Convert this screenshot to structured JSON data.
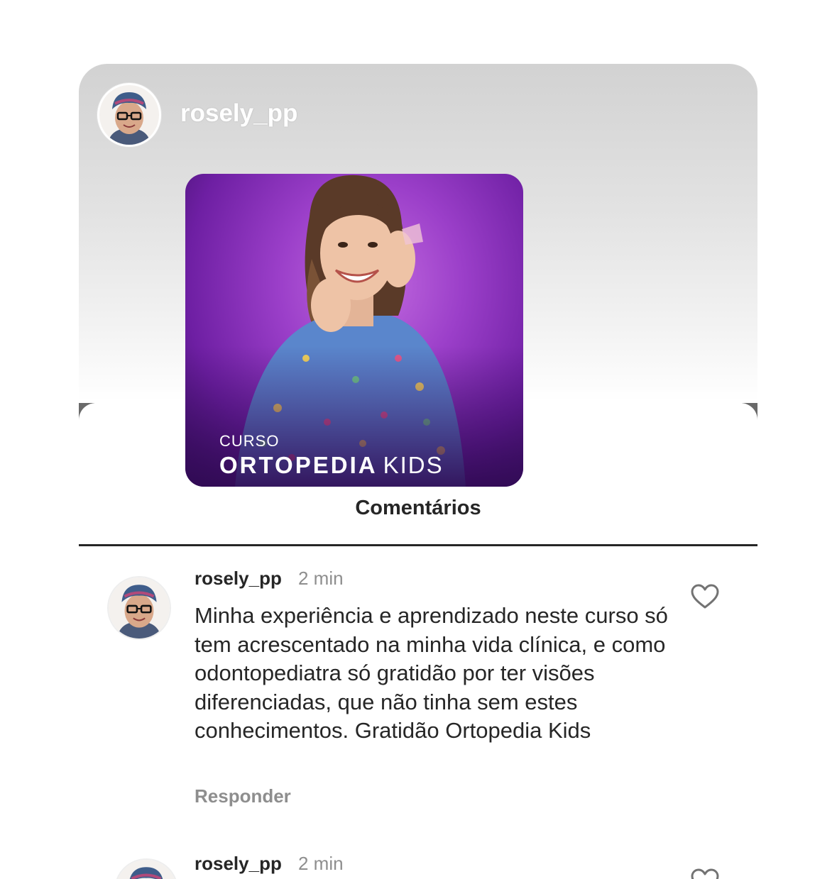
{
  "story": {
    "username": "rosely_pp",
    "avatar_icon": "user-avatar"
  },
  "post": {
    "label_small": "CURSO",
    "label_bold": "ORTOPEDIA",
    "label_light": "KIDS",
    "background_color": "#8a33c2"
  },
  "sheet": {
    "title": "Comentários"
  },
  "comments": [
    {
      "username": "rosely_pp",
      "time": "2 min",
      "text": "Minha experiência e aprendizado neste curso só tem acrescentado na minha vida clínica, e como odontopediatra só gratidão por ter visões diferenciadas, que não tinha sem estes conhecimentos. Gratidão Ortopedia Kids",
      "reply_label": "Responder",
      "like_icon": "heart-icon"
    },
    {
      "username": "rosely_pp",
      "time": "2 min",
      "like_icon": "heart-icon"
    }
  ]
}
